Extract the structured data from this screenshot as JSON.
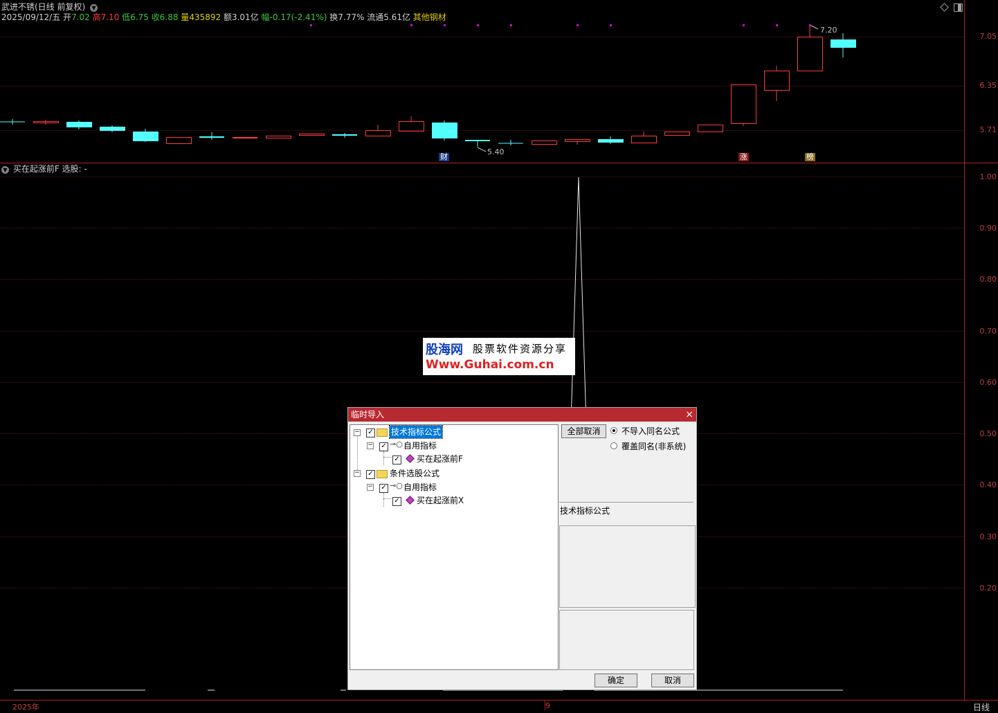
{
  "header": {
    "stock_title": "武进不锈(日线 前复权)",
    "date": "2025/09/12/五",
    "open_label": "开",
    "open_value": "7.02",
    "high_label": "高",
    "high_value": "7.10",
    "low_label": "低",
    "low_value": "6.75",
    "close_label": "收",
    "close_value": "6.88",
    "volume_label": "量",
    "volume_value": "435892",
    "amount_label": "额",
    "amount_value": "3.01亿",
    "change_label": "幅",
    "change_value": "-0.17(-2.41%)",
    "turnover_label": "换",
    "turnover_value": "7.77%",
    "float_label": "流通",
    "float_value": "5.61亿",
    "sector": "其他钢材"
  },
  "price_axis": [
    "7.05",
    "6.35",
    "5.71"
  ],
  "price_labels": {
    "high": "7.20",
    "low": "5.40"
  },
  "badges": {
    "cai": "财",
    "zhang": "涨",
    "bang": "榜"
  },
  "indicator": {
    "title": "买在起涨前F 选股: -",
    "axis": [
      "1.00",
      "0.90",
      "0.80",
      "0.70",
      "0.60",
      "0.50",
      "0.40",
      "0.30",
      "0.20"
    ]
  },
  "footer": {
    "year": "2025年",
    "month": "9",
    "period": "日线"
  },
  "watermark": {
    "site_name": "股海网",
    "slogan": "股票软件资源分享",
    "url": "Www.Guhai.com.cn"
  },
  "dialog": {
    "title": "临时导入",
    "close": "×",
    "tree": {
      "root1": "技术指标公式",
      "root1_child": "自用指标",
      "root1_leaf": "买在起涨前F",
      "root2": "条件选股公式",
      "root2_child": "自用指标",
      "root2_leaf": "买在起涨前X"
    },
    "deselect_all": "全部取消",
    "radio_skip": "不导入同名公式",
    "radio_overwrite": "覆盖同名(非系统)",
    "info_label": "技术指标公式",
    "ok": "确定",
    "cancel": "取消"
  },
  "colors": {
    "up": "#ff3b3b",
    "down": "#54ffff",
    "grid": "#5a1414",
    "dialog_title": "#b72a30"
  }
}
